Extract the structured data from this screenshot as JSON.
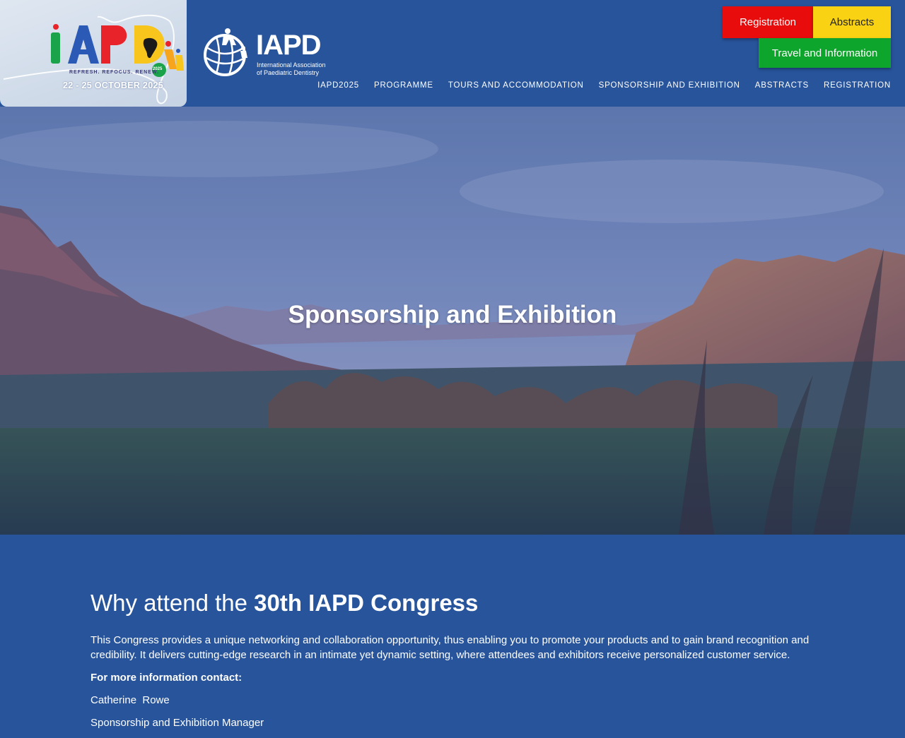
{
  "event_logo": {
    "letters": [
      "I",
      "A",
      "P",
      "D"
    ],
    "tagline": "REFRESH. REFOCUS. RENEW.",
    "badge": "2025",
    "dates": "22 - 25 OCTOBER 2025"
  },
  "org_logo": {
    "name": "IAPD",
    "subtitle_line1": "International Association",
    "subtitle_line2": "of Paediatric Dentistry"
  },
  "buttons": {
    "registration": "Registration",
    "abstracts": "Abstracts",
    "travel": "Travel and Information"
  },
  "nav": {
    "items": [
      {
        "label": "IAPD2025"
      },
      {
        "label": "PROGRAMME"
      },
      {
        "label": "TOURS AND ACCOMMODATION"
      },
      {
        "label": "SPONSORSHIP AND EXHIBITION"
      },
      {
        "label": "ABSTRACTS"
      },
      {
        "label": "REGISTRATION"
      }
    ]
  },
  "hero": {
    "title": "Sponsorship and Exhibition"
  },
  "content": {
    "heading_prefix": "Why attend the",
    "heading_bold": "30th IAPD Congress",
    "paragraph": "This Congress provides a unique networking and collaboration opportunity, thus enabling you to promote your products and to gain brand recognition and credibility. It delivers cutting-edge research in an intimate yet dynamic setting, where attendees and exhibitors receive personalized customer service.",
    "contact_label": "For more information contact:",
    "contact_name": "Catherine  Rowe",
    "contact_role": "Sponsorship and Exhibition Manager"
  },
  "colors": {
    "page_bg": "#27549b",
    "registration": "#e80c0c",
    "abstracts": "#f9d313",
    "travel": "#0da52b"
  }
}
